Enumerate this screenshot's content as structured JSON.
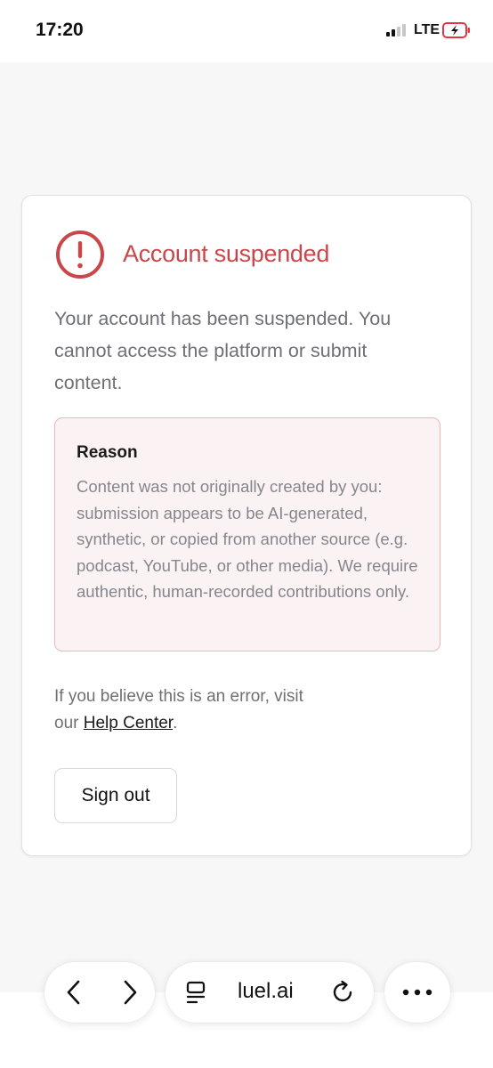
{
  "status_bar": {
    "time": "17:20",
    "network": "LTE"
  },
  "card": {
    "title": "Account suspended",
    "message": "Your account has been suspended. You cannot access the platform or submit content.",
    "reason": {
      "title": "Reason",
      "text": "Content was not originally created by you: submission appears to be AI-generated, synthetic, or copied from another source (e.g. podcast, YouTube, or other media). We require authentic, human-recorded contributions only."
    },
    "help": {
      "prefix": "If you believe this is an error, visit our ",
      "link": "Help Center",
      "suffix": "."
    },
    "signout_label": "Sign out"
  },
  "browser": {
    "url": "luel.ai"
  },
  "colors": {
    "danger": "#c9464b",
    "reason_bg": "#fbf3f3",
    "reason_border": "#efb6b9"
  }
}
